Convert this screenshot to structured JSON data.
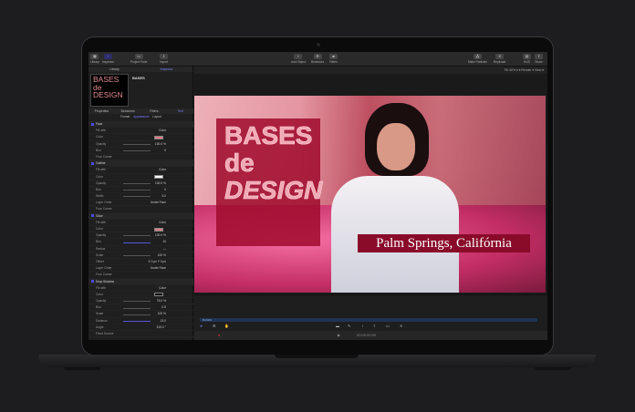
{
  "toolbar": {
    "library": "Library",
    "inspector": "Inspector",
    "project_pane": "Project Pane",
    "import": "Import",
    "add_object": "Add Object",
    "behaviors": "Behaviors",
    "filters": "Filters",
    "make_particles": "Make Particles",
    "replicate": "Replicate",
    "hud": "HUD",
    "share": "Share"
  },
  "sidebar": {
    "tabs": [
      "Library",
      "Inspector"
    ],
    "layer_name": "BASES",
    "thumb_lines": [
      "BASES",
      "de",
      "DESIGN"
    ],
    "subtabs": [
      "Properties",
      "Behaviors",
      "Filters",
      "Text"
    ],
    "segments": [
      "Format",
      "Appearance",
      "Layout"
    ],
    "rows": [
      {
        "type": "hdr",
        "label": "Face"
      },
      {
        "label": "Fill with",
        "value": "Color"
      },
      {
        "label": "Color",
        "swatch": "#e07a84"
      },
      {
        "label": "Opacity",
        "value": "100.0 %",
        "slider": 1
      },
      {
        "label": "Blur",
        "value": "0",
        "slider": 1
      },
      {
        "label": "Four Corner"
      },
      {
        "type": "hdr",
        "label": "Outline"
      },
      {
        "label": "Fill with",
        "value": "Color"
      },
      {
        "label": "Color",
        "swatch": "#ffffff"
      },
      {
        "label": "Opacity",
        "value": "100.0 %",
        "slider": 1
      },
      {
        "label": "Blur",
        "value": "0",
        "slider": 1
      },
      {
        "label": "Width",
        "value": "3.0",
        "slider": 1
      },
      {
        "label": "Layer Order",
        "value": "Under Face"
      },
      {
        "label": "Four Corner"
      },
      {
        "type": "hdr",
        "label": "Glow"
      },
      {
        "label": "Fill with",
        "value": "Color"
      },
      {
        "label": "Color",
        "swatch": "#e07a84"
      },
      {
        "label": "Opacity",
        "value": "100.0 %",
        "slider": 1
      },
      {
        "label": "Blur",
        "value": "10",
        "slider": 2
      },
      {
        "label": "Radius",
        "value": "—"
      },
      {
        "label": "Scale",
        "value": "100 %",
        "slider": 1
      },
      {
        "label": "Offset",
        "value": "X 0 px  Y 0 px"
      },
      {
        "label": "Layer Order",
        "value": "Under Face"
      },
      {
        "label": "Four Corner"
      },
      {
        "type": "hdr",
        "label": "Drop Shadow"
      },
      {
        "label": "Fill with",
        "value": "Color"
      },
      {
        "label": "Color",
        "swatch": "#000000"
      },
      {
        "label": "Opacity",
        "value": "75.0 %",
        "slider": 1
      },
      {
        "label": "Blur",
        "value": "0.5",
        "slider": 1
      },
      {
        "label": "Scale",
        "value": "100 %",
        "slider": 1
      },
      {
        "label": "Distance",
        "value": "13.0",
        "slider": 2
      },
      {
        "label": "Angle",
        "value": "315.0 °"
      },
      {
        "label": "Fixed Source"
      }
    ]
  },
  "canvas": {
    "viewbar": "Fit: 60% ▾   ▾   Render ▾   View ▾",
    "title_lines": [
      "BASES",
      "de",
      "DESIGN"
    ],
    "caption": "Palm Springs, Califórnia"
  },
  "timeline": {
    "track_label": "BASES",
    "timecode": "00:00:00:00"
  },
  "colors": {
    "accent": "#5656d8",
    "card": "#a00a2d",
    "caption_bg": "#8a0a2a"
  }
}
